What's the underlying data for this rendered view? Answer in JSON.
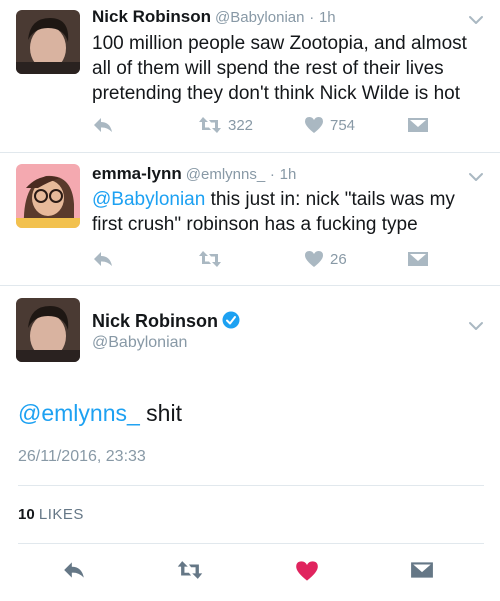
{
  "tweet1": {
    "name": "Nick Robinson",
    "handle": "@Babylonian",
    "dot": "·",
    "time": "1h",
    "text": "100 million people saw Zootopia, and almost all of them will spend the rest of their lives pretending they don't think Nick Wilde is hot",
    "retweets": "322",
    "likes": "754"
  },
  "tweet2": {
    "name": "emma-lynn",
    "handle": "@emlynns_",
    "dot": "·",
    "time": "1h",
    "mention": "@Babylonian",
    "text": " this just in: nick \"tails was my first crush\" robinson has a fucking type",
    "likes": "26"
  },
  "main": {
    "name": "Nick Robinson",
    "handle": "@Babylonian",
    "mention": "@emlynns_",
    "text": " shit",
    "timestamp": "26/11/2016, 23:33",
    "likes_count": "10",
    "likes_label": "LIKES"
  },
  "colors": {
    "accent": "#1da1f2",
    "muted": "#8899a6",
    "like_active": "#e0245e",
    "divider": "#e1e8ed",
    "icon_dark": "#657786"
  },
  "icons": {
    "reply": "reply-icon",
    "retweet": "retweet-icon",
    "like": "heart-icon",
    "dm": "envelope-icon",
    "more": "chevron-down-icon",
    "verified": "verified-badge-icon"
  }
}
